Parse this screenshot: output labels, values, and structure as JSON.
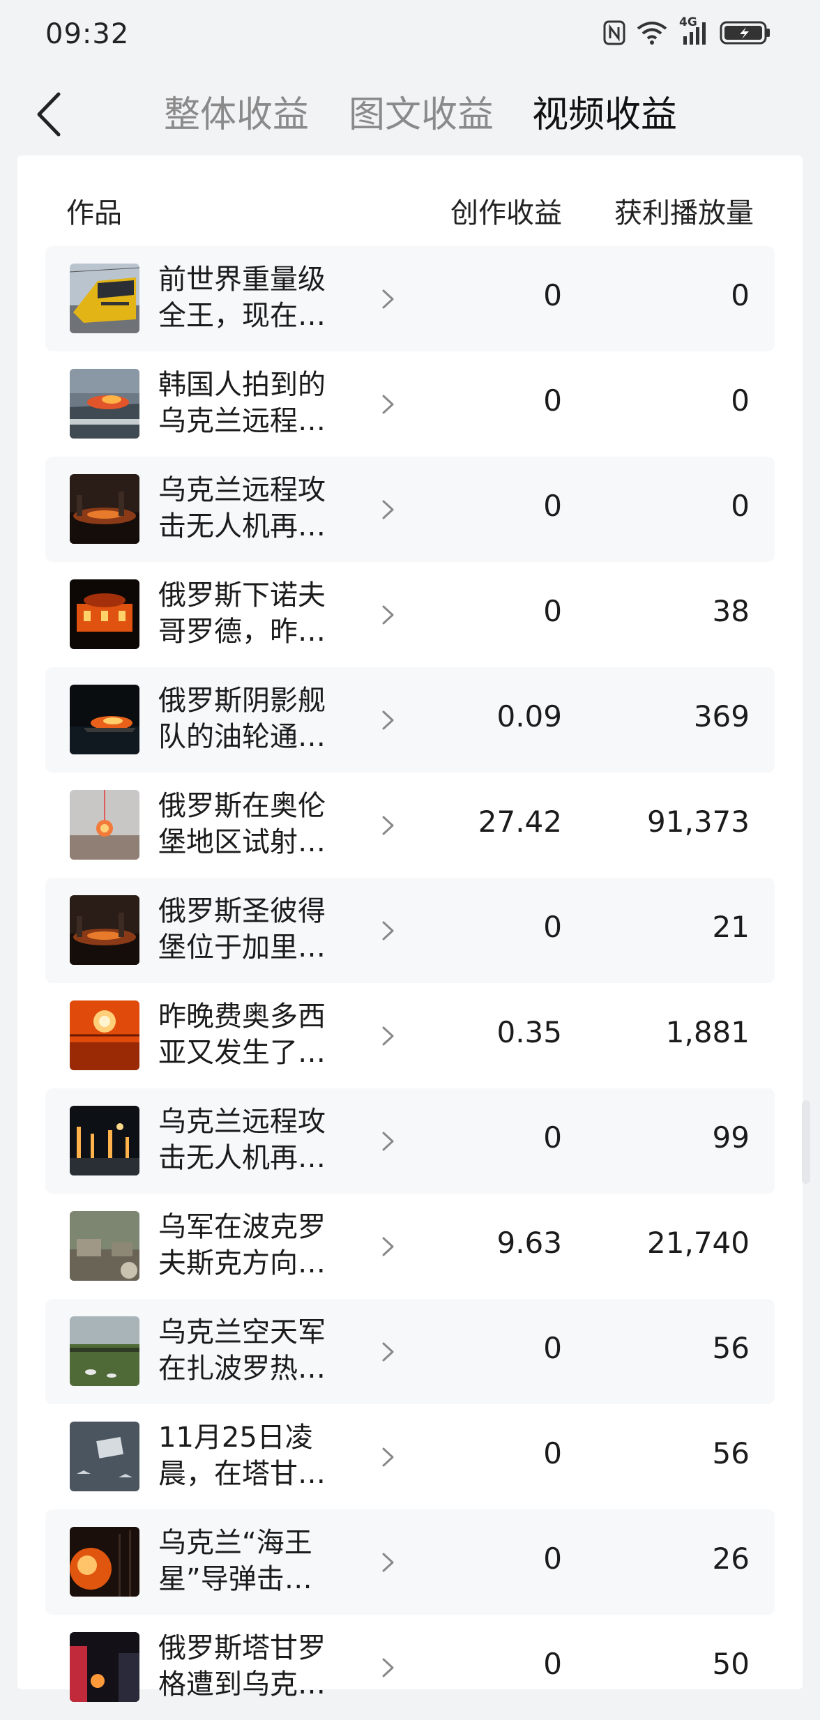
{
  "status_bar": {
    "time": "09:32",
    "network": "4G"
  },
  "header": {
    "tabs": [
      {
        "label": "整体收益",
        "active": false
      },
      {
        "label": "图文收益",
        "active": false
      },
      {
        "label": "视频收益",
        "active": true
      }
    ]
  },
  "table": {
    "columns": {
      "work": "作品",
      "income": "创作收益",
      "plays": "获利播放量"
    },
    "rows": [
      {
        "title_line1": "前世界重量级",
        "title_line2": "全王，现在…",
        "income": "0",
        "plays": "0",
        "thumb": "tram-thumbnail"
      },
      {
        "title_line1": "韩国人拍到的",
        "title_line2": "乌克兰远程…",
        "income": "0",
        "plays": "0",
        "thumb": "ship-fire-thumbnail"
      },
      {
        "title_line1": "乌克兰远程攻",
        "title_line2": "击无人机再…",
        "income": "0",
        "plays": "0",
        "thumb": "night-fire-thumbnail"
      },
      {
        "title_line1": "俄罗斯下诺夫",
        "title_line2": "哥罗德，昨…",
        "income": "0",
        "plays": "38",
        "thumb": "building-fire-thumbnail"
      },
      {
        "title_line1": "俄罗斯阴影舰",
        "title_line2": "队的油轮通…",
        "income": "0.09",
        "plays": "369",
        "thumb": "tanker-fire-thumbnail"
      },
      {
        "title_line1": "俄罗斯在奥伦",
        "title_line2": "堡地区试射…",
        "income": "27.42",
        "plays": "91,373",
        "thumb": "missile-test-thumbnail"
      },
      {
        "title_line1": "俄罗斯圣彼得",
        "title_line2": "堡位于加里…",
        "income": "0",
        "plays": "21",
        "thumb": "night-fire-thumbnail"
      },
      {
        "title_line1": "昨晚费奥多西",
        "title_line2": "亚又发生了…",
        "income": "0.35",
        "plays": "1,881",
        "thumb": "explosion-thumbnail"
      },
      {
        "title_line1": "乌克兰远程攻",
        "title_line2": "击无人机再…",
        "income": "0",
        "plays": "99",
        "thumb": "refinery-thumbnail"
      },
      {
        "title_line1": "乌军在波克罗",
        "title_line2": "夫斯克方向…",
        "income": "9.63",
        "plays": "21,740",
        "thumb": "ruins-thumbnail"
      },
      {
        "title_line1": "乌克兰空天军",
        "title_line2": "在扎波罗热…",
        "income": "0",
        "plays": "56",
        "thumb": "field-thumbnail"
      },
      {
        "title_line1": "11月25日凌",
        "title_line2": "晨，在塔甘…",
        "income": "0",
        "plays": "56",
        "thumb": "aerial-thumbnail"
      },
      {
        "title_line1": "乌克兰“海王",
        "title_line2": "星”导弹击…",
        "income": "0",
        "plays": "26",
        "thumb": "forest-fire-thumbnail"
      },
      {
        "title_line1": "俄罗斯塔甘罗",
        "title_line2": "格遭到乌克…",
        "income": "0",
        "plays": "50",
        "thumb": "street-fire-thumbnail"
      }
    ]
  }
}
